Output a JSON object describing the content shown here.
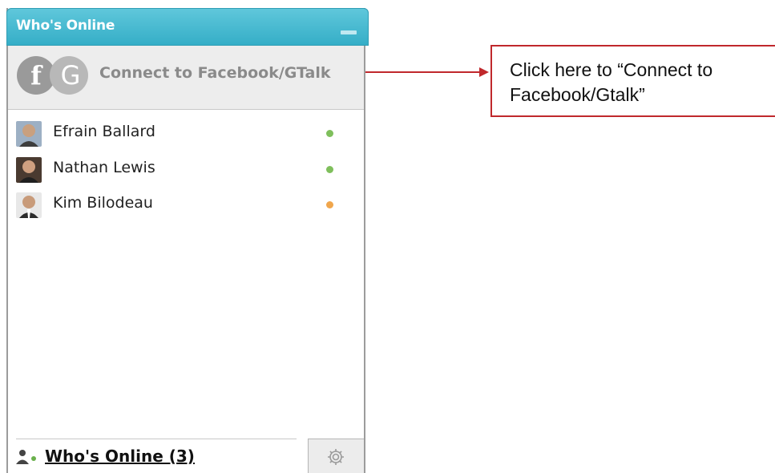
{
  "widget": {
    "title": "Who's Online",
    "connect_label": "Connect to Facebook/GTalk",
    "logo_letters": "fG",
    "footer_link": "Who's Online (3)"
  },
  "contacts": [
    {
      "name": "Efrain Ballard",
      "status": "online",
      "status_color": "#7fbf5c"
    },
    {
      "name": "Nathan Lewis",
      "status": "online",
      "status_color": "#7fbf5c"
    },
    {
      "name": "Kim Bilodeau",
      "status": "away",
      "status_color": "#f0a64c"
    }
  ],
  "callout": {
    "text": "Click here to “Connect to Facebook/Gtalk”"
  },
  "colors": {
    "titlebar": "#35aec7",
    "callout_border": "#c0282c"
  }
}
